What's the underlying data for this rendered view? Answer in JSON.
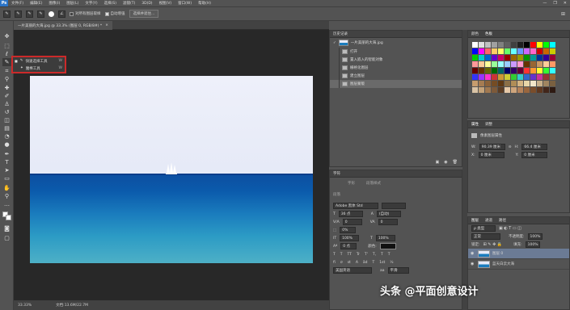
{
  "app": {
    "logo": "Ps"
  },
  "menu": [
    "文件(F)",
    "编辑(E)",
    "图像(I)",
    "图层(L)",
    "文字(Y)",
    "选择(S)",
    "滤镜(T)",
    "3D(D)",
    "视图(V)",
    "窗口(W)",
    "帮助(H)"
  ],
  "window_controls": [
    "—",
    "❐",
    "✕"
  ],
  "options_bar": {
    "sample_all_layers": "对所有图层取样",
    "auto_enhance": "自动增强",
    "select_subject": "选择并遮住..."
  },
  "document": {
    "tab_title": "一片美丽的大海.jpg @ 33.3% (图层 0, RGB/8#) *",
    "close": "×"
  },
  "status": {
    "zoom": "33.33%",
    "doc": "文档:13.6M/22.7M"
  },
  "tool_menu": {
    "items": [
      {
        "label": "快速选择工具",
        "shortcut": "W",
        "selected": true
      },
      {
        "label": "魔棒工具",
        "shortcut": "W",
        "selected": false
      }
    ]
  },
  "history_panel": {
    "tab": "历史记录",
    "snapshot": "一片美丽的大海.jpg",
    "items": [
      "打开",
      "置入嵌入的智能对象",
      "栅格化图层",
      "建立图层",
      "图层蒙版"
    ]
  },
  "color_panel": {
    "tabs": [
      "颜色",
      "色板"
    ]
  },
  "properties_panel": {
    "tabs": [
      "属性",
      "调整"
    ],
    "title": "像素图层属性",
    "w_label": "W:",
    "w_value": "90.39 厘米",
    "h_label": "H:",
    "h_value": "66.4 厘米",
    "x_label": "X:",
    "x_value": "0 厘米",
    "y_label": "Y:",
    "y_value": "0 厘米"
  },
  "character_panel": {
    "tabs": [
      "字符",
      "段落"
    ],
    "other_tabs": [
      "字形",
      "段落样式"
    ],
    "font_family": "Adobe 黑体 Std",
    "size": "36 点",
    "leading": "(自动)",
    "kerning": "0",
    "tracking": "0%",
    "vscale": "100%",
    "hscale": "100%",
    "baseline": "0 点",
    "color_label": "颜色:",
    "lang": "美国英语",
    "aa": "aa",
    "aa_mode": "平滑",
    "styles": [
      "T",
      "T",
      "TT",
      "Tr",
      "T'",
      "T,",
      "T",
      "T"
    ]
  },
  "layers_panel": {
    "tabs": [
      "图层",
      "通道",
      "路径"
    ],
    "blend_mode": "正常",
    "opacity_label": "不透明度:",
    "opacity": "100%",
    "lock_label": "锁定:",
    "fill_label": "填充:",
    "fill": "100%",
    "layers": [
      {
        "name": "图层 0",
        "selected": true
      },
      {
        "name": "蓝天白云大海",
        "selected": false
      }
    ]
  },
  "watermark": "头条 @平面创意设计"
}
